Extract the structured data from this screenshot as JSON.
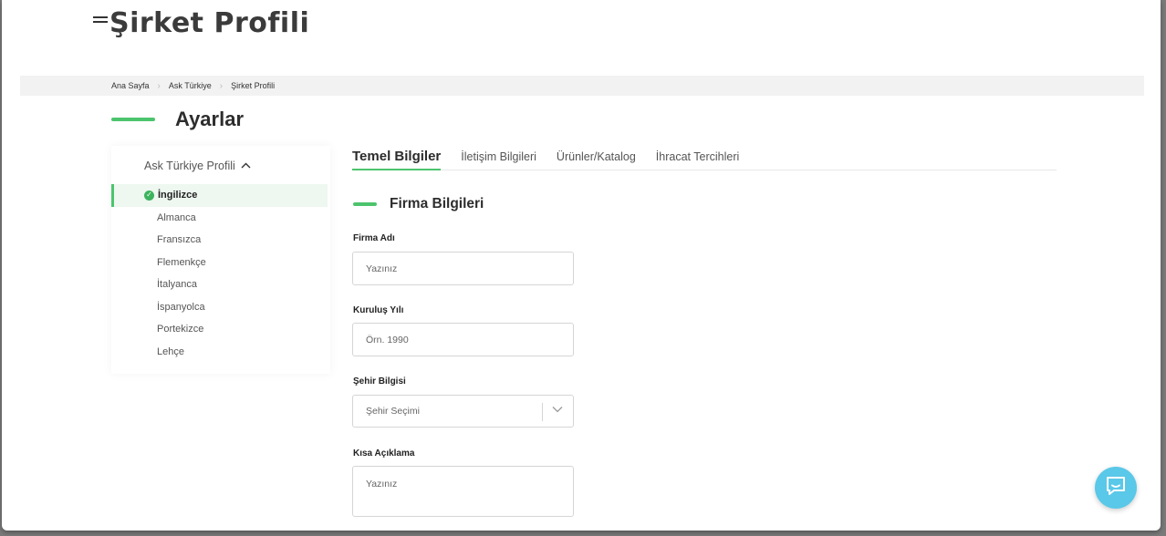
{
  "page": {
    "title": "Şirket Profili"
  },
  "breadcrumb": [
    "Ana Sayfa",
    "Ask Türkiye",
    "Şirket Profili"
  ],
  "section": {
    "title": "Ayarlar"
  },
  "sidebar": {
    "header": "Ask Türkiye Profili",
    "header_icon": "chevron-up-icon",
    "items": [
      {
        "label": "İngilizce",
        "active": true
      },
      {
        "label": "Almanca"
      },
      {
        "label": "Fransızca"
      },
      {
        "label": "Flemenkçe"
      },
      {
        "label": "İtalyanca"
      },
      {
        "label": "İspanyolca"
      },
      {
        "label": "Portekizce"
      },
      {
        "label": "Lehçe"
      }
    ]
  },
  "tabs": [
    {
      "label": "Temel Bilgiler",
      "active": true
    },
    {
      "label": "İletişim Bilgileri"
    },
    {
      "label": "Ürünler/Katalog"
    },
    {
      "label": "İhracat Tercihleri"
    }
  ],
  "form": {
    "section_title": "Firma Bilgileri",
    "fields": {
      "company_name": {
        "label": "Firma Adı",
        "placeholder": "Yazınız"
      },
      "founded_year": {
        "label": "Kuruluş Yılı",
        "placeholder": "Örn. 1990"
      },
      "city": {
        "label": "Şehir Bilgisi",
        "placeholder": "Şehir Seçimi"
      },
      "description": {
        "label": "Kısa Açıklama",
        "placeholder": "Yazınız"
      }
    }
  },
  "colors": {
    "accent": "#4cc46e",
    "chat": "#5ac8e8",
    "breadcrumb_bg": "#f2f2f2"
  },
  "icons": {
    "menu": "hamburger-menu-icon",
    "active_language": "check-circle-icon",
    "chat": "chat-message-icon"
  }
}
